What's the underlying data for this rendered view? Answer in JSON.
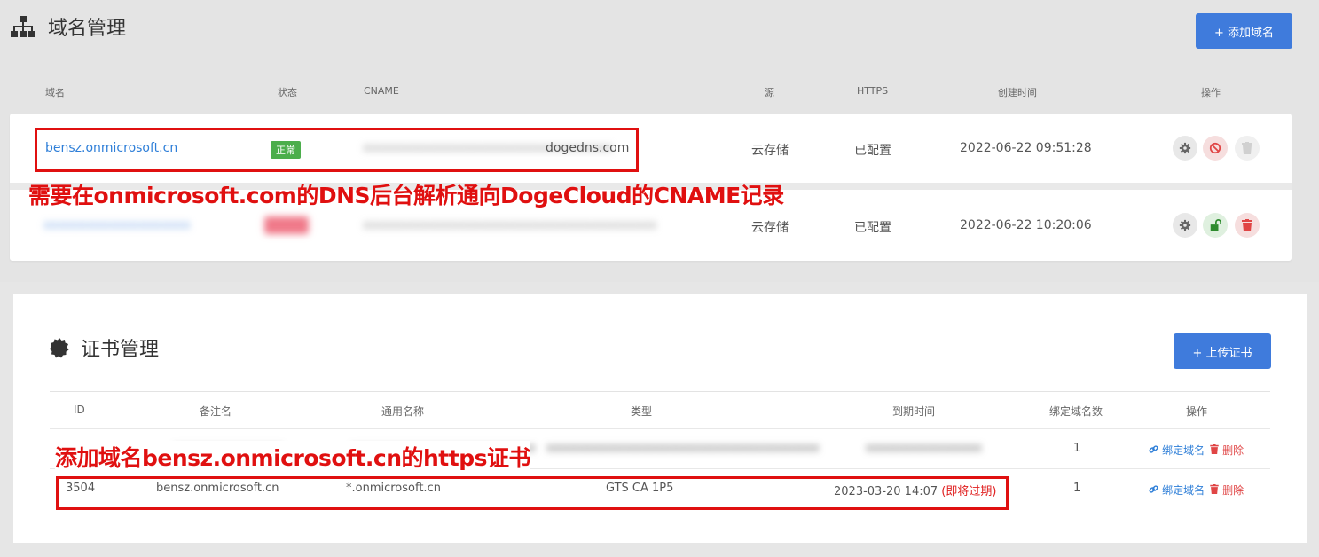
{
  "domain_section": {
    "title": "域名管理",
    "add_button": "+ 添加域名",
    "columns": {
      "domain": "域名",
      "status": "状态",
      "cname": "CNAME",
      "source": "源",
      "https": "HTTPS",
      "created": "创建时间",
      "actions": "操作"
    },
    "rows": [
      {
        "domain": "bensz.onmicrosoft.cn",
        "status": "正常",
        "cname_suffix": "dogedns.com",
        "source": "云存储",
        "https": "已配置",
        "created": "2022-06-22 09:51:28"
      },
      {
        "source": "云存储",
        "https": "已配置",
        "created": "2022-06-22 10:20:06"
      }
    ],
    "annotation": "需要在onmicrosoft.com的DNS后台解析通向DogeCloud的CNAME记录"
  },
  "cert_section": {
    "title": "证书管理",
    "upload_button": "+ 上传证书",
    "columns": {
      "id": "ID",
      "note": "备注名",
      "common_name": "通用名称",
      "type": "类型",
      "expire": "到期时间",
      "bound_count": "绑定域名数",
      "actions": "操作"
    },
    "rows": [
      {
        "bound_count": "1",
        "bind_label": "绑定域名",
        "delete_label": "删除"
      },
      {
        "id": "3504",
        "note": "bensz.onmicrosoft.cn",
        "common_name": "*.onmicrosoft.cn",
        "type": "GTS CA 1P5",
        "expire": "2023-03-20 14:07",
        "expire_warning": "(即将过期)",
        "bound_count": "1",
        "bind_label": "绑定域名",
        "delete_label": "删除"
      }
    ],
    "annotation": "添加域名bensz.onmicrosoft.cn的https证书"
  },
  "colors": {
    "primary": "#3f7bdc",
    "annotation_red": "#e01010",
    "status_green": "#4cae4c",
    "link_blue": "#2f7fd8"
  }
}
